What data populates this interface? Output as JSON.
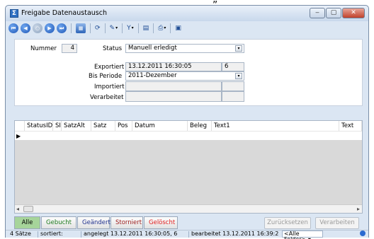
{
  "cut_text": "„",
  "window": {
    "title": "Freigabe Datenaustausch",
    "icon": "sigma-icon"
  },
  "titlebar_buttons": {
    "minimize": "‒",
    "maximize": "▢",
    "close": "✕"
  },
  "toolbar": {
    "nav": [
      "⏮",
      "◀",
      "○",
      "▶",
      "⏭"
    ],
    "icons": [
      "table-icon",
      "refresh-icon",
      "tools-icon",
      "filter-icon",
      "document-icon",
      "print-icon",
      "save-icon"
    ],
    "dropdown_arrow": "▾"
  },
  "form": {
    "nummer_label": "Nummer",
    "nummer_value": "4",
    "status_label": "Status",
    "status_value": "Manuell erledigt",
    "exportiert_label": "Exportiert",
    "exportiert_value": "13.12.2011 16:30:05",
    "exportiert_extra": "6",
    "bis_periode_label": "Bis Periode",
    "bis_periode_value": "2011-Dezember",
    "importiert_label": "Importiert",
    "verarbeitet_label": "Verarbeitet",
    "dropdown_arrow": "▾"
  },
  "grid": {
    "columns": [
      "StatusID",
      "SI",
      "SatzAlt",
      "Satz",
      "Pos",
      "Datum",
      "Beleg",
      "Text1",
      "Text"
    ],
    "row_marker": "▶",
    "scroll_left": "◂",
    "scroll_right": "▸"
  },
  "filter_buttons": [
    {
      "label": "Alle",
      "color": "#000000",
      "bg": "#a6d49a"
    },
    {
      "label": "Gebucht",
      "color": "#1c7a1c"
    },
    {
      "label": "Geändert",
      "color": "#1f2f8c"
    },
    {
      "label": "Storniert",
      "color": "#9a1a1a"
    },
    {
      "label": "Gelöscht",
      "color": "#e02020"
    }
  ],
  "actions": {
    "reset": "Zurücksetzen",
    "process": "Verarbeiten"
  },
  "statusbar": {
    "count": "4 Sätze",
    "sorted": "sortiert:",
    "created": "angelegt 13.12.2011 16:30:05, 6",
    "edited": "bearbeitet 13.12.2011 16:39:2",
    "fields": "<Alle Felder>",
    "dropdown_arrow": "▾"
  }
}
